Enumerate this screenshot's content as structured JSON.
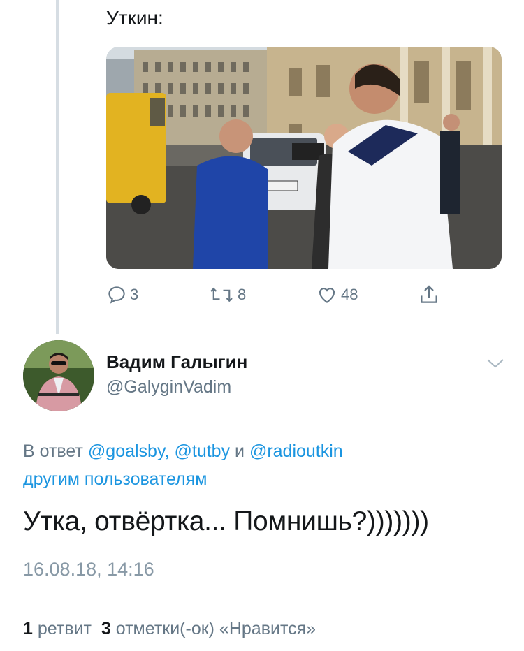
{
  "parent_tweet": {
    "text": "Уткин:",
    "actions": {
      "replies": "3",
      "retweets": "8",
      "likes": "48"
    },
    "icons": [
      "reply-icon",
      "retweet-icon",
      "like-icon",
      "share-icon"
    ]
  },
  "reply_tweet": {
    "display_name": "Вадим Галыгин",
    "handle": "@GalyginVadim",
    "reply_prefix": "В ответ ",
    "mention_1": "@goalsby,",
    "mention_2": "@tutby",
    "conjunction": " и ",
    "mention_3": "@radioutkin",
    "others_link": "другим пользователям",
    "text": "Утка, отвёртка... Помнишь?)))))))",
    "timestamp": "16.08.18, 14:16",
    "retweets_count": "1",
    "retweets_label": "ретвит",
    "likes_count": "3",
    "likes_label": "отметки(-ок) «Нравится»"
  },
  "colors": {
    "text_primary": "#14171a",
    "text_secondary": "#657786",
    "link": "#1b95e0",
    "thread_line": "#d6dde3",
    "divider": "#e1e8ed"
  }
}
